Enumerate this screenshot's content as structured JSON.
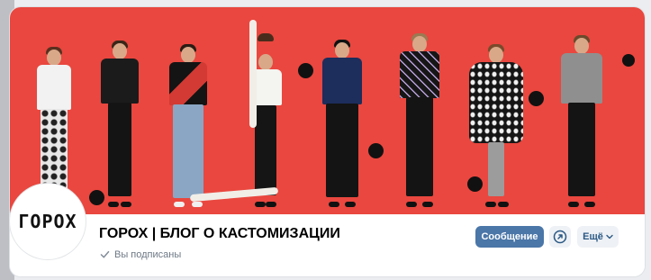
{
  "group": {
    "title": "ГОРОХ | БЛОГ О КАСТОМИЗАЦИИ",
    "subscription_status": "Вы подписаны",
    "logo_text": "ГОРОХ"
  },
  "actions": {
    "message_label": "Сообщение",
    "more_label": "Ещё"
  },
  "colors": {
    "cover_background": "#e9473f",
    "primary_button": "#4a76a8",
    "secondary_button": "#eef1f5"
  },
  "icons": {
    "subscribed": "check-icon",
    "circle_action": "arrow-up-right-circle-icon",
    "more": "chevron-down-icon"
  }
}
